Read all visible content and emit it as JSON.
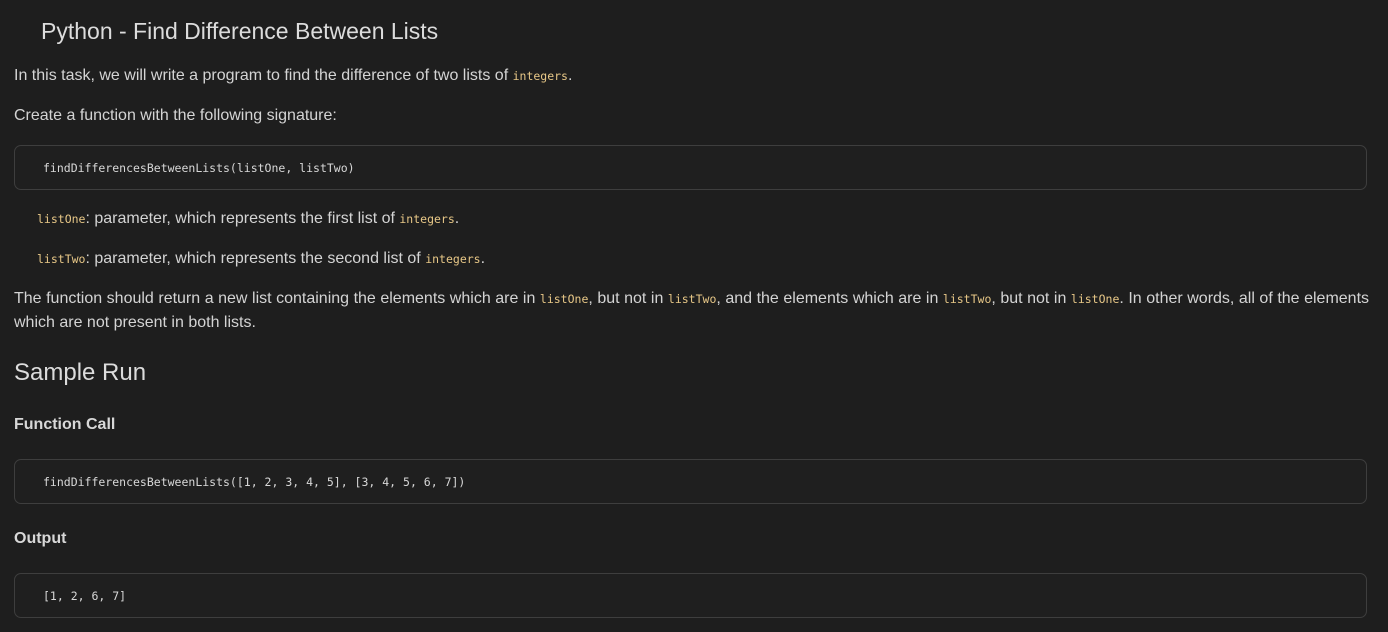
{
  "title": "Python - Find Difference Between Lists",
  "intro": {
    "text_before": "In this task, we will write a program to find the difference of two lists of ",
    "code": "integers",
    "text_after": "."
  },
  "signature_label": "Create a function with the following signature:",
  "signature_code": "findDifferencesBetweenLists(listOne, listTwo)",
  "params": [
    {
      "name": "listOne",
      "desc": ": parameter, which represents the first list of ",
      "type": "integers",
      "end": "."
    },
    {
      "name": "listTwo",
      "desc": ": parameter, which represents the second list of ",
      "type": "integers",
      "end": "."
    }
  ],
  "description": {
    "t1": "The function should return a new list containing the elements which are in ",
    "c1": "listOne",
    "t2": ", but not in ",
    "c2": "listTwo",
    "t3": ", and the elements which are in ",
    "c3": "listTwo",
    "t4": ", but not in ",
    "c4": "listOne",
    "t5": ". In other words, all of the elements which are not present in both lists."
  },
  "sample_run": {
    "heading": "Sample Run",
    "call_heading": "Function Call",
    "call_code": "findDifferencesBetweenLists([1, 2, 3, 4, 5], [3, 4, 5, 6, 7])",
    "output_heading": "Output",
    "output_code": "[1, 2, 6, 7]"
  },
  "colors": {
    "background": "#1e1e1e",
    "text": "#d4d4d4",
    "inline_code": "#e7c787",
    "code_border": "#3e3e3e"
  }
}
